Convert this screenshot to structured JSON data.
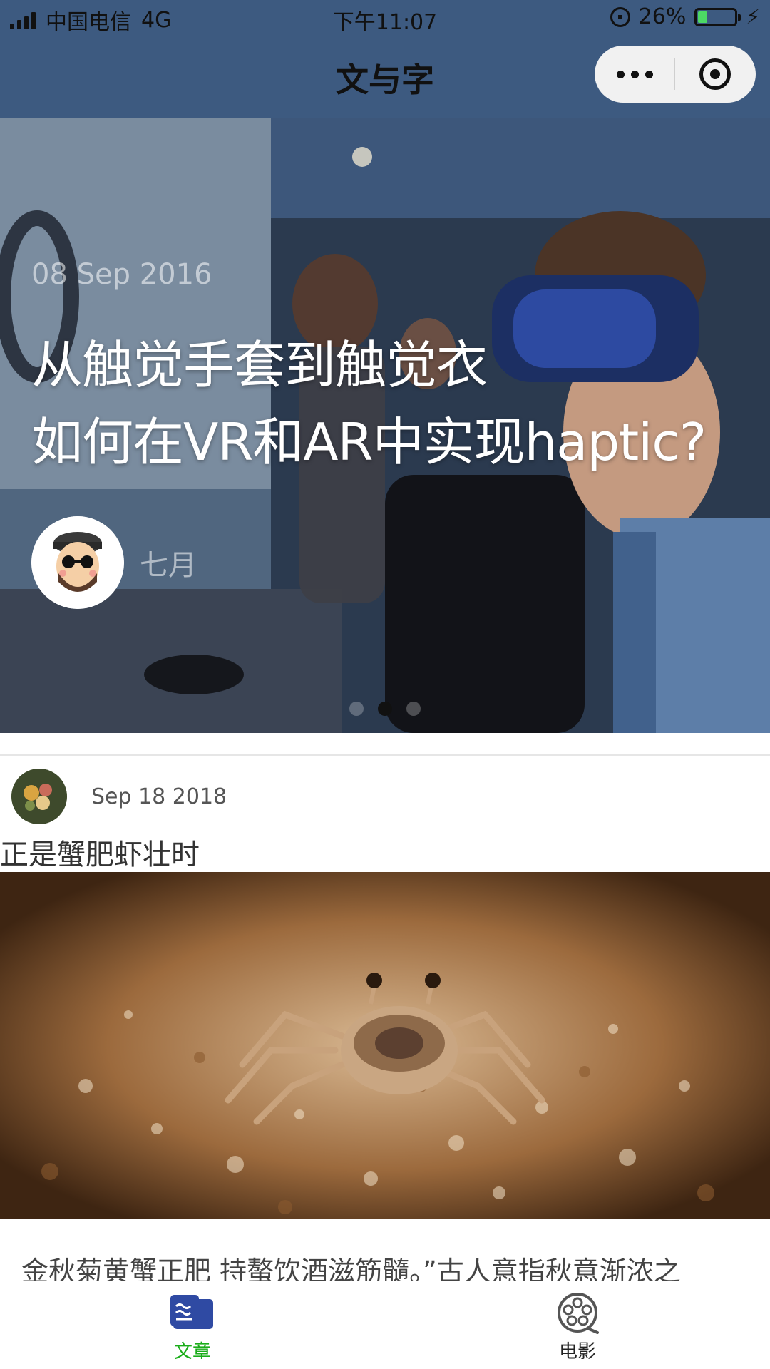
{
  "status_bar": {
    "carrier": "中国电信",
    "network": "4G",
    "time": "下午11:07",
    "battery": "26%",
    "battery_level": 0.26
  },
  "nav": {
    "title": "文与字"
  },
  "banner": {
    "date": "08 Sep 2016",
    "title_line1": "从触觉手套到触觉衣",
    "title_line2": "如何在VR和AR中实现haptic?",
    "author": "七月",
    "slide_count": 3,
    "active_slide": 2
  },
  "post": {
    "date": "Sep 18 2018",
    "title": "正是蟹肥虾壮时",
    "excerpt": "金秋菊黄蟹正肥 持螯饮酒滋筋髓。”古人意指秋意渐浓之"
  },
  "tabs": [
    {
      "label": "文章",
      "icon": "article-icon",
      "active": true,
      "color": "#1aad19"
    },
    {
      "label": "电影",
      "icon": "film-reel-icon",
      "active": false,
      "color": "#222222"
    }
  ],
  "colors": {
    "nav_background": "#3d5a80",
    "tab_active": "#1aad19",
    "article_icon": "#2f4aa3"
  }
}
